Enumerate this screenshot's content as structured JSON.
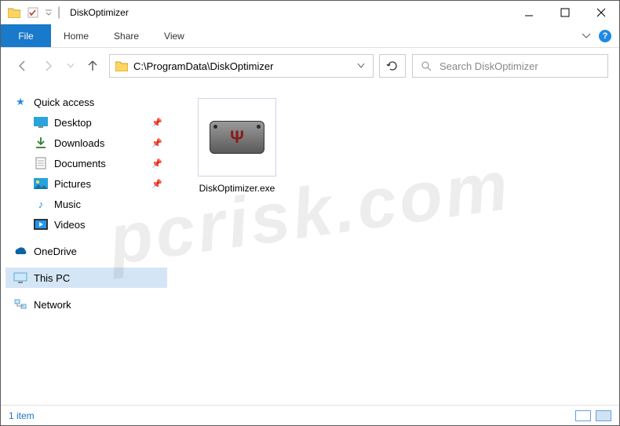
{
  "window": {
    "title": "DiskOptimizer"
  },
  "ribbon": {
    "file": "File",
    "tabs": [
      "Home",
      "Share",
      "View"
    ]
  },
  "nav": {
    "path": "C:\\ProgramData\\DiskOptimizer",
    "search_placeholder": "Search DiskOptimizer"
  },
  "sidebar": {
    "quick_access": "Quick access",
    "items": [
      {
        "label": "Desktop",
        "pinned": true
      },
      {
        "label": "Downloads",
        "pinned": true
      },
      {
        "label": "Documents",
        "pinned": true
      },
      {
        "label": "Pictures",
        "pinned": true
      },
      {
        "label": "Music",
        "pinned": false
      },
      {
        "label": "Videos",
        "pinned": false
      }
    ],
    "onedrive": "OneDrive",
    "thispc": "This PC",
    "network": "Network"
  },
  "content": {
    "files": [
      {
        "name": "DiskOptimizer.exe"
      }
    ]
  },
  "status": {
    "count": "1 item"
  },
  "watermark": "pcrisk.com"
}
